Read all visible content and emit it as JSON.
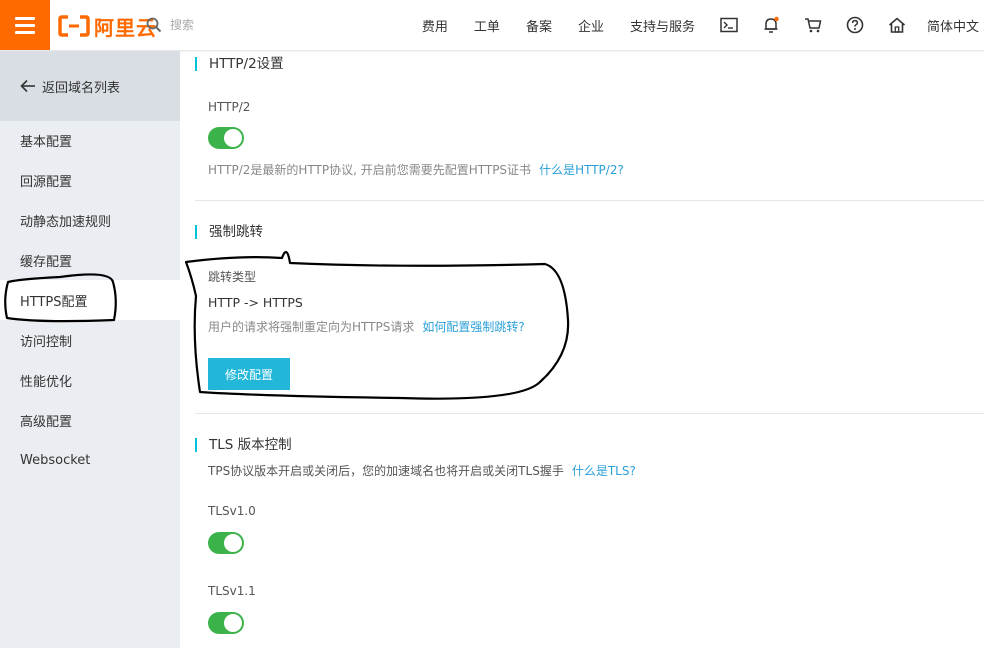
{
  "header": {
    "logo_text": "阿里云",
    "search_placeholder": "搜索",
    "nav": [
      "费用",
      "工单",
      "备案",
      "企业",
      "支持与服务"
    ],
    "icons": [
      "terminal-icon",
      "bell-icon",
      "cart-icon",
      "help-icon",
      "home-icon"
    ],
    "language": "简体中文",
    "accent_color": "#ff6a00"
  },
  "sidebar": {
    "back_label": "返回域名列表",
    "items": [
      {
        "label": "基本配置"
      },
      {
        "label": "回源配置"
      },
      {
        "label": "动静态加速规则"
      },
      {
        "label": "缓存配置"
      },
      {
        "label": "HTTPS配置",
        "active": true
      },
      {
        "label": "访问控制"
      },
      {
        "label": "性能优化"
      },
      {
        "label": "高级配置"
      },
      {
        "label": "Websocket"
      }
    ]
  },
  "main": {
    "http2": {
      "title": "HTTP/2设置",
      "label": "HTTP/2",
      "enabled": true,
      "help": "HTTP/2是最新的HTTP协议, 开启前您需要先配置HTTPS证书",
      "link": "什么是HTTP/2?"
    },
    "redirect": {
      "title": "强制跳转",
      "type_label": "跳转类型",
      "value": "HTTP -> HTTPS",
      "help": "用户的请求将强制重定向为HTTPS请求",
      "link": "如何配置强制跳转?",
      "button": "修改配置"
    },
    "tls": {
      "title": "TLS 版本控制",
      "help": "TPS协议版本开启或关闭后，您的加速域名也将开启或关闭TLS握手",
      "link": "什么是TLS?",
      "versions": [
        {
          "label": "TLSv1.0",
          "enabled": true
        },
        {
          "label": "TLSv1.1",
          "enabled": true
        }
      ]
    },
    "toggle_color": "#3cb34a",
    "link_color": "#2ba0d8",
    "button_color": "#22b7d8"
  }
}
